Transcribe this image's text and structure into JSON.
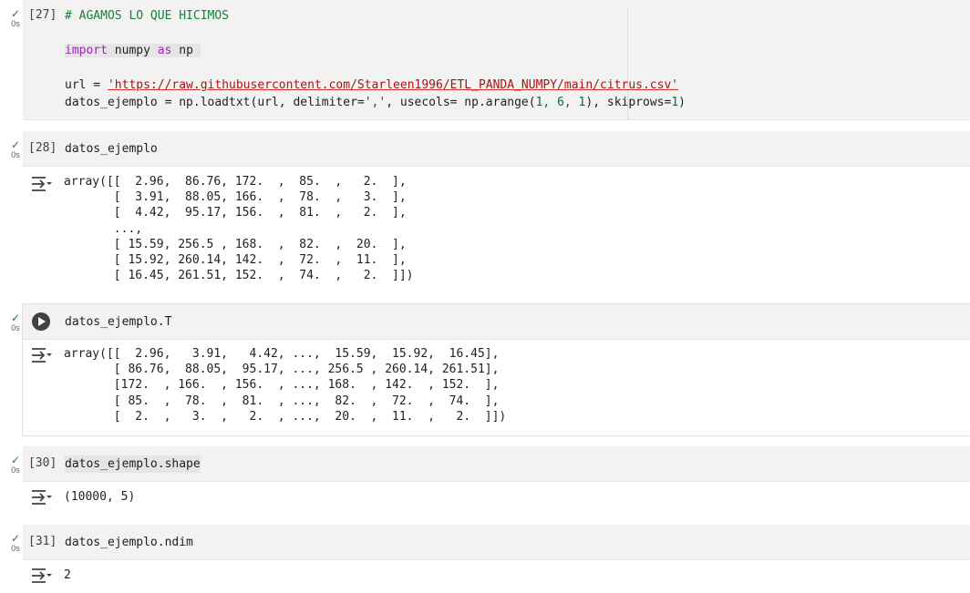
{
  "cells": [
    {
      "exec_count": "[27]",
      "status_time": "0s",
      "code_lines": {
        "comment": "# AGAMOS LO QUE HICIMOS",
        "import_kw": "import",
        "import_mod": "numpy",
        "as_kw": "as",
        "alias": "np",
        "url_var": "url = ",
        "url_value": "'https://raw.githubusercontent.com/Starleen1996/ETL_PANDA_NUMPY/main/citrus.csv'",
        "load_prefix": "datos_ejemplo = np.loadtxt(url, delimiter=",
        "load_delim": "','",
        "load_mid": ", usecols= np.arange(",
        "arange_args": "1, 6, 1",
        "load_mid2": "), skiprows=",
        "skip_val": "1",
        "load_end": ")"
      }
    },
    {
      "exec_count": "[28]",
      "status_time": "0s",
      "code": "datos_ejemplo",
      "output": "array([[  2.96,  86.76, 172.  ,  85.  ,   2.  ],\n       [  3.91,  88.05, 166.  ,  78.  ,   3.  ],\n       [  4.42,  95.17, 156.  ,  81.  ,   2.  ],\n       ...,\n       [ 15.59, 256.5 , 168.  ,  82.  ,  20.  ],\n       [ 15.92, 260.14, 142.  ,  72.  ,  11.  ],\n       [ 16.45, 261.51, 152.  ,  74.  ,   2.  ]])"
    },
    {
      "exec_count": "",
      "status_time": "0s",
      "code": "datos_ejemplo.T",
      "output": "array([[  2.96,   3.91,   4.42, ...,  15.59,  15.92,  16.45],\n       [ 86.76,  88.05,  95.17, ..., 256.5 , 260.14, 261.51],\n       [172.  , 166.  , 156.  , ..., 168.  , 142.  , 152.  ],\n       [ 85.  ,  78.  ,  81.  , ...,  82.  ,  72.  ,  74.  ],\n       [  2.  ,   3.  ,   2.  , ...,  20.  ,  11.  ,   2.  ]])"
    },
    {
      "exec_count": "[30]",
      "status_time": "0s",
      "code": "datos_ejemplo.shape",
      "output": "(10000, 5)"
    },
    {
      "exec_count": "[31]",
      "status_time": "0s",
      "code": "datos_ejemplo.ndim",
      "output": "2"
    }
  ],
  "icons": {
    "status": "check-icon",
    "output_toggle": "output-toggle-icon",
    "run": "run-cell-icon"
  },
  "colors": {
    "success": "#188038",
    "keyword": "#9c27b0",
    "string": "#a31515",
    "number": "#116644"
  }
}
